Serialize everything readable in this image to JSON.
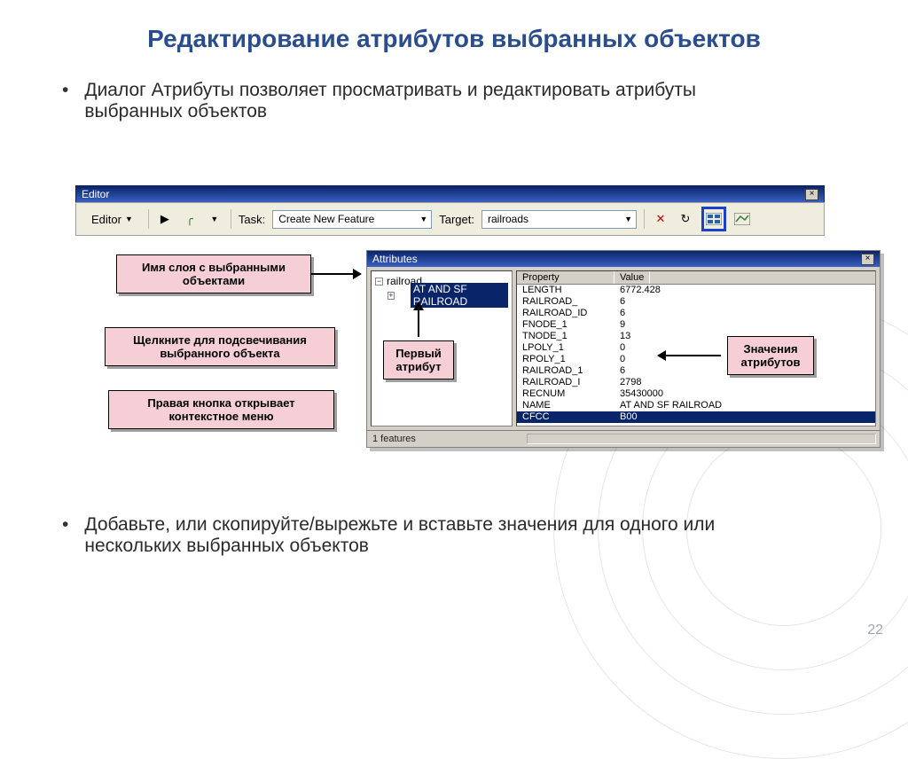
{
  "slide": {
    "title": "Редактирование атрибутов выбранных объектов",
    "bullet1": "Диалог Атрибуты позволяет просматривать и  редактировать атрибуты выбранных объектов",
    "bullet2": "Добавьте, или скопируйте/вырежьте и вставьте значения для одного или нескольких выбранных объектов",
    "pagenum": "22"
  },
  "toolbar": {
    "title": "Editor",
    "editor_btn": "Editor",
    "task_label": "Task:",
    "task_value": "Create New Feature",
    "target_label": "Target:",
    "target_value": "railroads"
  },
  "attrwin": {
    "title": "Attributes",
    "tree_root": "railroad",
    "tree_item": "AT AND SF RAILROAD",
    "header_prop": "Property",
    "header_val": "Value",
    "rows": [
      {
        "p": "LENGTH",
        "v": "6772.428"
      },
      {
        "p": "RAILROAD_",
        "v": "6"
      },
      {
        "p": "RAILROAD_ID",
        "v": "6"
      },
      {
        "p": "FNODE_1",
        "v": "9"
      },
      {
        "p": "TNODE_1",
        "v": "13"
      },
      {
        "p": "LPOLY_1",
        "v": "0"
      },
      {
        "p": "RPOLY_1",
        "v": "0"
      },
      {
        "p": "RAILROAD_1",
        "v": "6"
      },
      {
        "p": "RAILROAD_I",
        "v": "2798"
      },
      {
        "p": "RECNUM",
        "v": "35430000"
      },
      {
        "p": "NAME",
        "v": "AT AND SF RAILROAD"
      },
      {
        "p": "CFCC",
        "v": "B00"
      }
    ],
    "status": "1 features"
  },
  "callouts": {
    "c1": "Имя слоя с выбранными объектами",
    "c2": "Щелкните для подсвечивания выбранного объекта",
    "c3": "Правая кнопка открывает контекстное меню",
    "c4a": "Первый",
    "c4b": "атрибут",
    "c5a": "Значения",
    "c5b": "атрибутов"
  }
}
